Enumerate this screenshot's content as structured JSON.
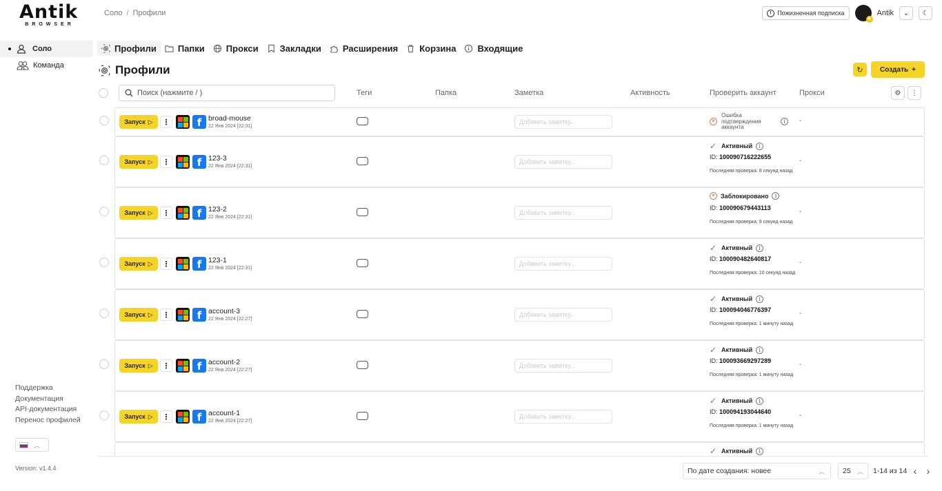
{
  "app": {
    "logo_main": "Antik",
    "logo_sub": "BROWSER",
    "breadcrumb": [
      "Соло",
      "Профили"
    ],
    "breadcrumb_sep": "/",
    "subscription_label": "Пожизненная подписка",
    "username": "Antik"
  },
  "sidebar": {
    "items": [
      {
        "label": "Соло",
        "icon": "user-icon",
        "active": true
      },
      {
        "label": "Команда",
        "icon": "users-icon",
        "active": false
      }
    ],
    "links": [
      "Поддержка",
      "Документация",
      "API-документация",
      "Перенос профилей"
    ],
    "version": "Version: v1.4.4"
  },
  "tabs": [
    {
      "label": "Профили",
      "icon": "fingerprint-icon",
      "active": true
    },
    {
      "label": "Папки",
      "icon": "folder-icon",
      "active": false
    },
    {
      "label": "Прокси",
      "icon": "globe-icon",
      "active": false
    },
    {
      "label": "Закладки",
      "icon": "bookmark-icon",
      "active": false
    },
    {
      "label": "Расширения",
      "icon": "puzzle-icon",
      "active": false
    },
    {
      "label": "Корзина",
      "icon": "trash-icon",
      "active": false
    },
    {
      "label": "Входящие",
      "icon": "info-icon",
      "active": false
    }
  ],
  "page": {
    "title": "Профили",
    "create_label": "Создать",
    "search_placeholder": "Поиск (нажмите / )"
  },
  "columns": [
    "Теги",
    "Папка",
    "Заметка",
    "Активность",
    "Проверить аккаунт",
    "Прокси"
  ],
  "profiles": [
    {
      "name": "broad-mouse",
      "date": "22 Янв 2024 [22:31]",
      "status": "error",
      "status_text": "Ошибка подтверждения аккаунта",
      "id_label": "",
      "account_id": "",
      "last_check": "",
      "proxy": "-"
    },
    {
      "name": "123-3",
      "date": "22 Янв 2024 [22:31]",
      "status": "ok",
      "status_text": "Активный",
      "id_label": "ID:",
      "account_id": "100090716222655",
      "last_check": "Последняя проверка: 8 секунд назад",
      "proxy": "-"
    },
    {
      "name": "123-2",
      "date": "22 Янв 2024 [22:31]",
      "status": "blocked",
      "status_text": "Заблокировано",
      "id_label": "ID:",
      "account_id": "100090679443113",
      "last_check": "Последняя проверка: 9 секунд назад",
      "proxy": "-"
    },
    {
      "name": "123-1",
      "date": "22 Янв 2024 [22:31]",
      "status": "ok",
      "status_text": "Активный",
      "id_label": "ID:",
      "account_id": "100090482640817",
      "last_check": "Последняя проверка: 10 секунд назад",
      "proxy": "-"
    },
    {
      "name": "account-3",
      "date": "22 Янв 2024 [22:27]",
      "status": "ok",
      "status_text": "Активный",
      "id_label": "ID:",
      "account_id": "100094046776397",
      "last_check": "Последняя проверка: 1 минуту назад",
      "proxy": "-"
    },
    {
      "name": "account-2",
      "date": "22 Янв 2024 [22:27]",
      "status": "ok",
      "status_text": "Активный",
      "id_label": "ID:",
      "account_id": "100093669297289",
      "last_check": "Последняя проверка: 1 минуту назад",
      "proxy": "-"
    },
    {
      "name": "account-1",
      "date": "22 Янв 2024 [22:27]",
      "status": "ok",
      "status_text": "Активный",
      "id_label": "ID:",
      "account_id": "100094193044640",
      "last_check": "Последняя проверка: 1 минуту назад",
      "proxy": "-"
    },
    {
      "name": "",
      "date": "",
      "status": "ok",
      "status_text": "Активный",
      "id_label": "",
      "account_id": "",
      "last_check": "",
      "proxy": ""
    }
  ],
  "row_common": {
    "launch_label": "Запуск",
    "note_placeholder": "Добавить заметку..."
  },
  "footer": {
    "sort_value": "По дате создания: новее",
    "per_page": "25",
    "range": "1-14 из 14"
  },
  "colors": {
    "accent_yellow": "#f5d42a",
    "ok_green": "#3aa34a",
    "error_orange": "#e07a4f",
    "facebook_blue": "#1877f2"
  }
}
